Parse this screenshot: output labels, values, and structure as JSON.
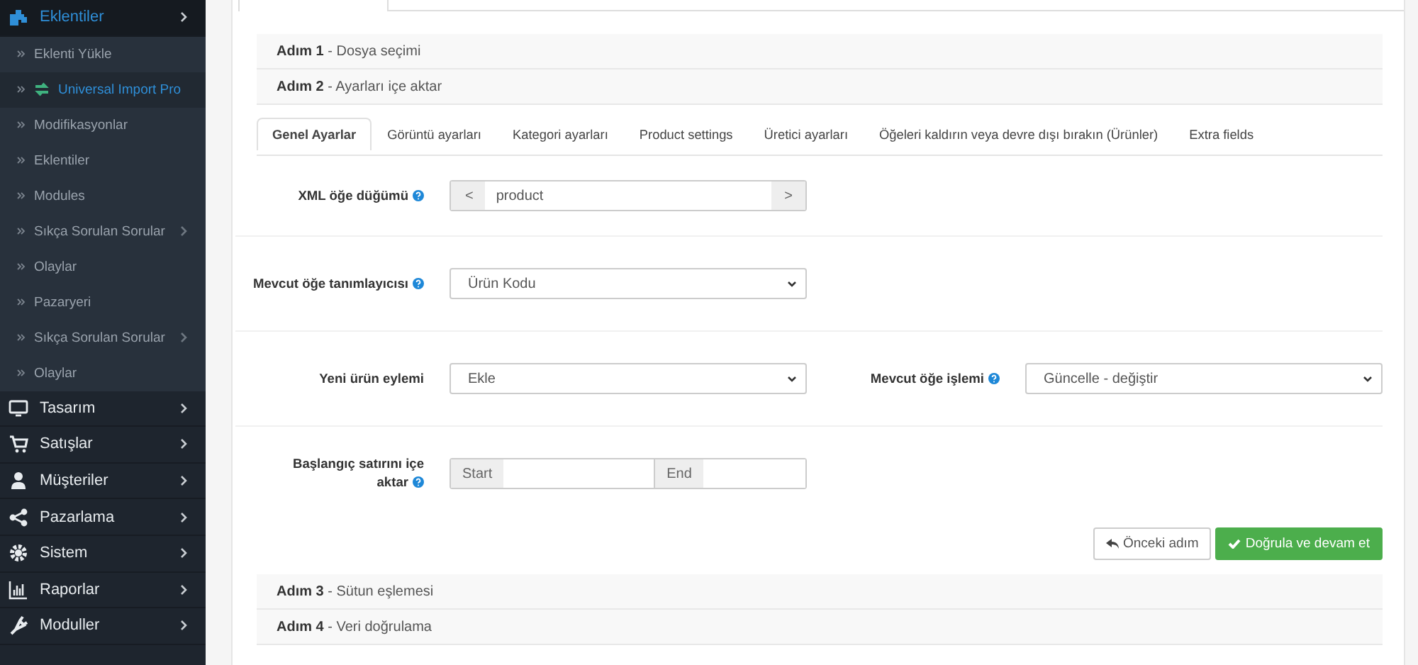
{
  "sidebar": {
    "items": [
      {
        "label": "Eklentiler",
        "selected": true,
        "children": [
          {
            "label": "Eklenti Yükle",
            "selected": false,
            "submenu": false,
            "icon": false
          },
          {
            "label": "Universal Import Pro",
            "selected": true,
            "submenu": false,
            "icon": true
          },
          {
            "label": "Modifikasyonlar",
            "selected": false,
            "submenu": false,
            "icon": false
          },
          {
            "label": "Eklentiler",
            "selected": false,
            "submenu": false,
            "icon": false
          },
          {
            "label": "Modules",
            "selected": false,
            "submenu": false,
            "icon": false
          },
          {
            "label": "Sıkça Sorulan Sorular",
            "selected": false,
            "submenu": true,
            "icon": false
          },
          {
            "label": "Olaylar",
            "selected": false,
            "submenu": false,
            "icon": false
          },
          {
            "label": "Pazaryeri",
            "selected": false,
            "submenu": false,
            "icon": false
          },
          {
            "label": "Sıkça Sorulan Sorular",
            "selected": false,
            "submenu": true,
            "icon": false
          },
          {
            "label": "Olaylar",
            "selected": false,
            "submenu": false,
            "icon": false
          }
        ]
      },
      {
        "label": "Tasarım",
        "selected": false
      },
      {
        "label": "Satışlar",
        "selected": false
      },
      {
        "label": "Müşteriler",
        "selected": false
      },
      {
        "label": "Pazarlama",
        "selected": false
      },
      {
        "label": "Sistem",
        "selected": false
      },
      {
        "label": "Raporlar",
        "selected": false
      },
      {
        "label": "Moduller",
        "selected": false
      }
    ]
  },
  "steps_before": [
    "**Adım 1** - Dosya seçimi",
    "**Adım 2** - Ayarları içe aktar"
  ],
  "tabs": [
    {
      "label": "Genel Ayarlar",
      "selected": true
    },
    {
      "label": "Görüntü ayarları",
      "selected": false
    },
    {
      "label": "Kategori ayarları",
      "selected": false
    },
    {
      "label": "Product settings",
      "selected": false
    },
    {
      "label": "Üretici ayarları",
      "selected": false
    },
    {
      "label": "Öğeleri kaldırın veya devre dışı bırakın (Ürünler)",
      "selected": false
    },
    {
      "label": "Extra fields",
      "selected": false
    }
  ],
  "form_rows": [
    {
      "fields": [
        {
          "kind": "addon-input",
          "label": "XML öğe düğümü",
          "help": true,
          "prefix": "<",
          "value": "product",
          "suffix": ">"
        }
      ]
    },
    {
      "fields": [
        {
          "kind": "select",
          "label": "Mevcut öğe tanımlayıcısı",
          "help": true,
          "value": "Ürün Kodu"
        }
      ]
    },
    {
      "fields": [
        {
          "kind": "select",
          "label": "Yeni ürün eylemi",
          "help": false,
          "value": "Ekle"
        },
        {
          "kind": "select",
          "label": "Mevcut öğe işlemi",
          "help": true,
          "value": "Güncelle - değiştir"
        }
      ]
    },
    {
      "fields": [
        {
          "kind": "range",
          "label": "Başlangıç satırını içe aktar",
          "help": true,
          "start": "Start",
          "end": "End"
        }
      ]
    }
  ],
  "buttons": [
    {
      "kind": "back",
      "label": "Önceki adım"
    },
    {
      "kind": "primary",
      "label": "Doğrula ve devam et"
    }
  ],
  "steps_after": [
    "**Adım 3** - Sütun eşlemesi",
    "**Adım 4** - Veri doğrulama"
  ]
}
